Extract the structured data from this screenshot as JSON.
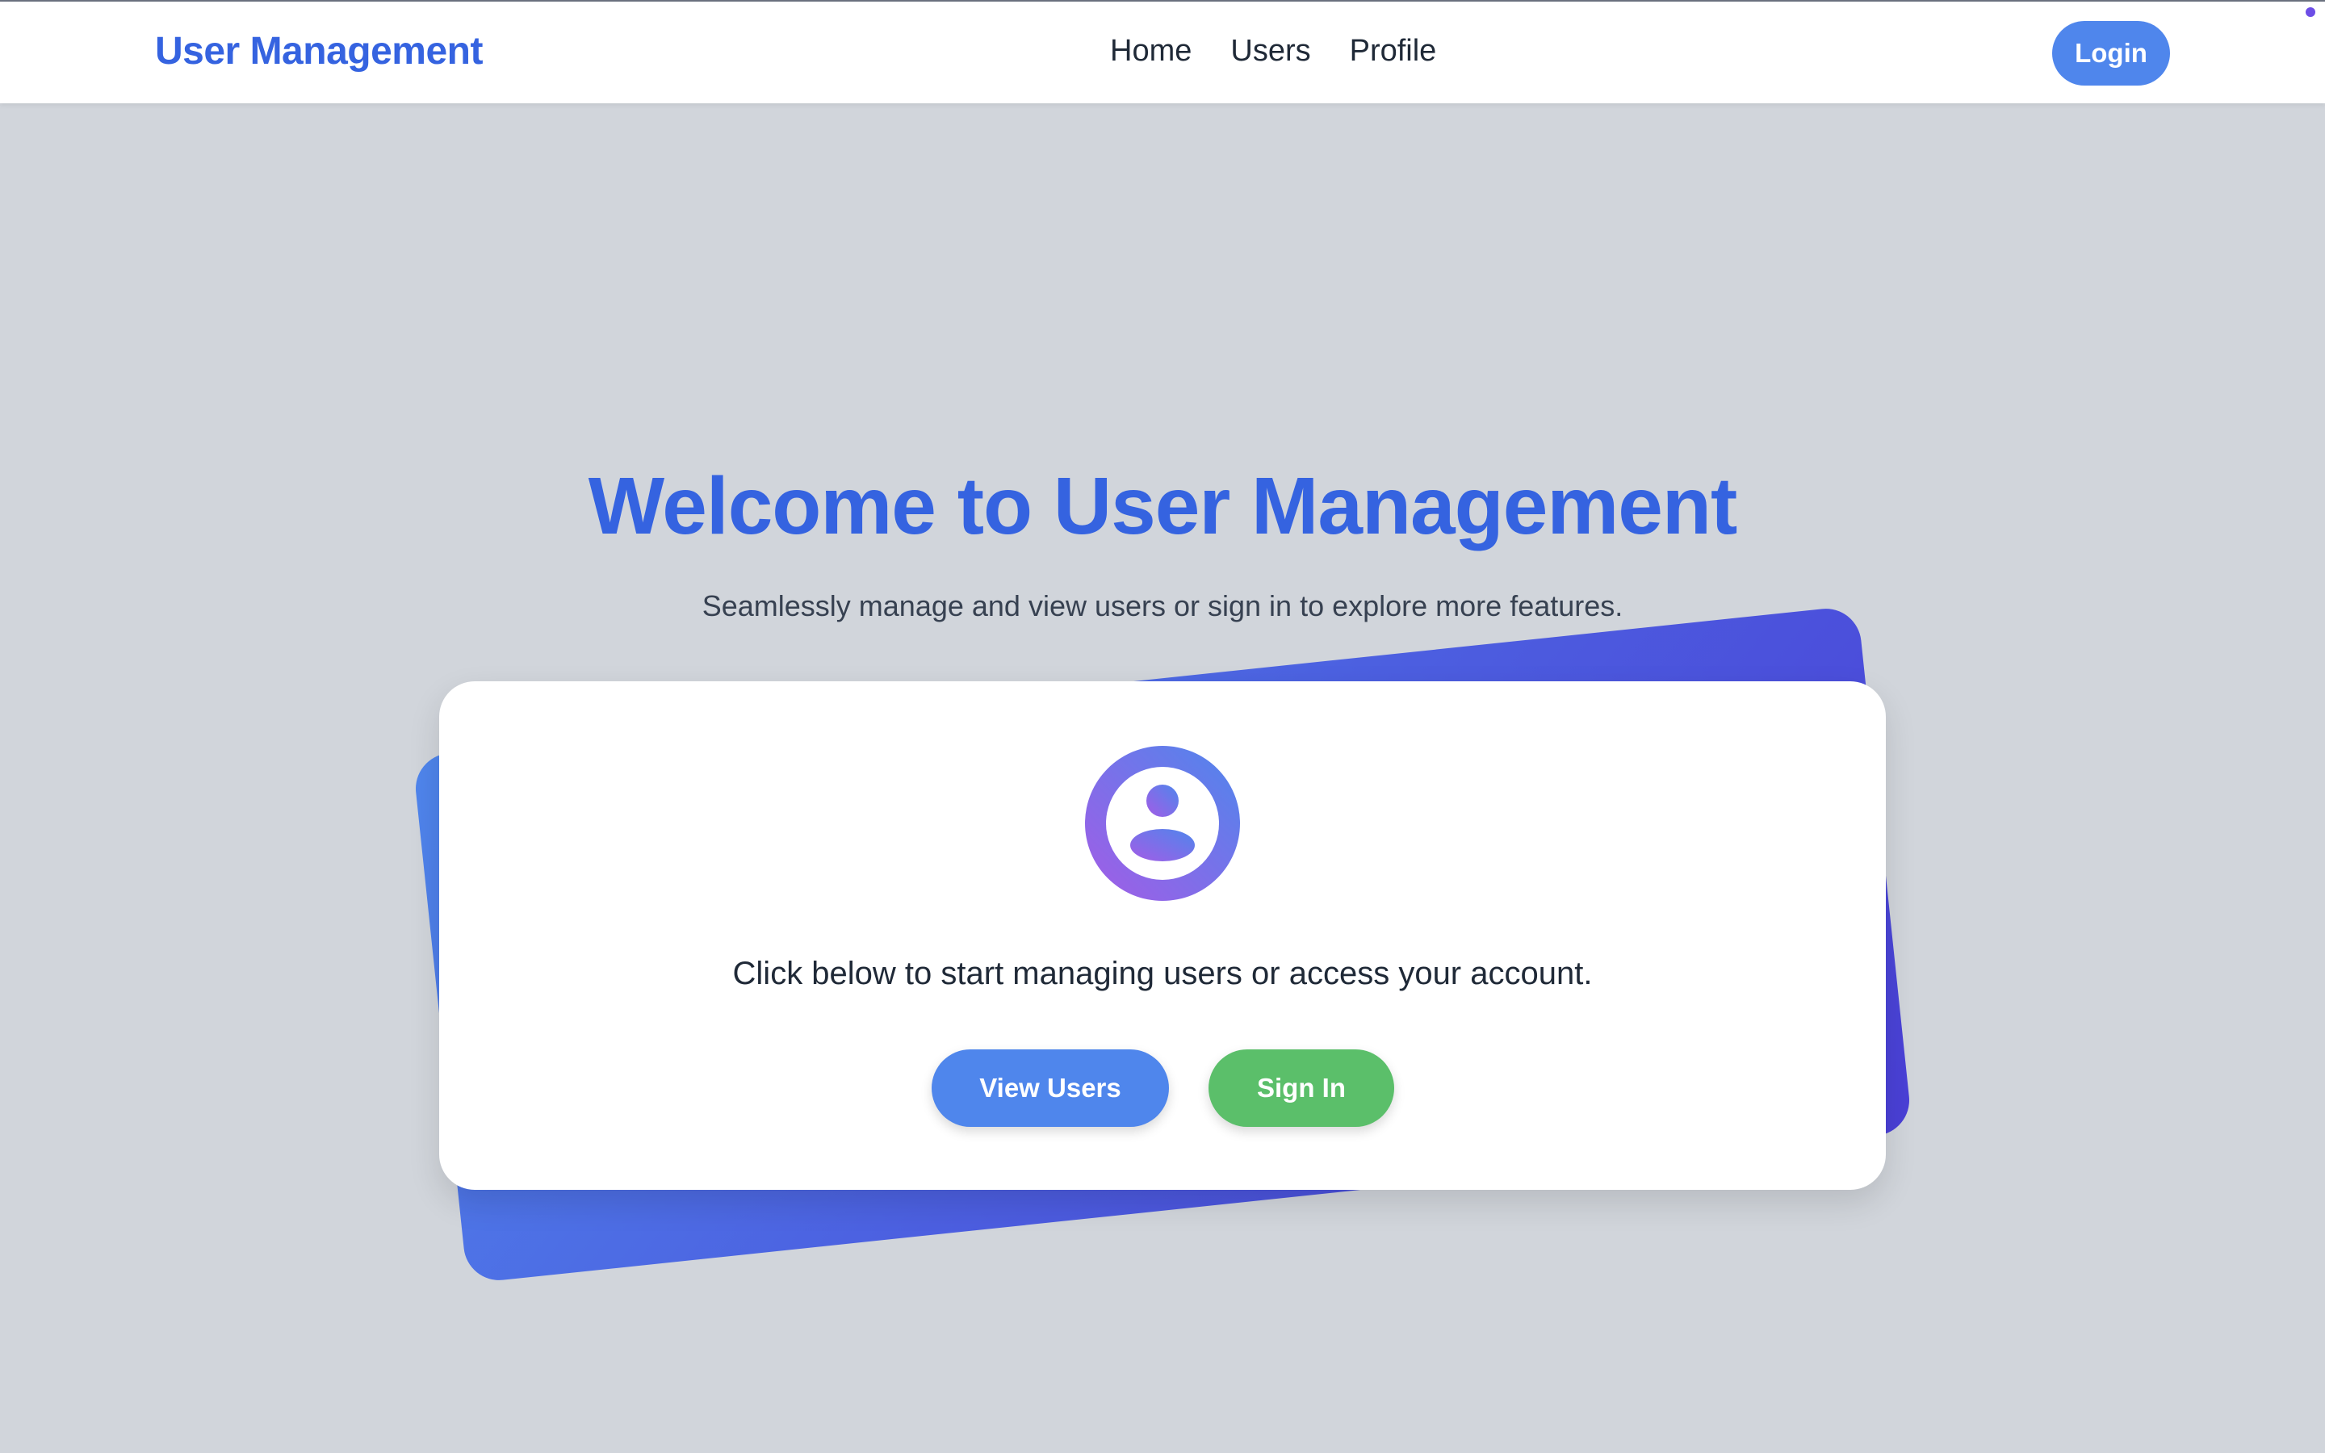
{
  "nav": {
    "brand": "User Management",
    "links": [
      "Home",
      "Users",
      "Profile"
    ],
    "login_label": "Login"
  },
  "hero": {
    "title": "Welcome to User Management",
    "subtitle": "Seamlessly manage and view users or sign in to explore more features."
  },
  "card": {
    "message": "Click below to start managing users or access your account.",
    "view_users_label": "View Users",
    "sign_in_label": "Sign In",
    "icon": "user-circle-icon"
  },
  "colors": {
    "brand": "#3563e0",
    "primary_button": "#4f86ec",
    "success_button": "#5bbf6a",
    "gradient_start": "#4f86ec",
    "gradient_end": "#4a3fd6",
    "icon_gradient_start": "#9a5ee8",
    "icon_gradient_end": "#4f86ec",
    "background": "#d1d5db"
  }
}
